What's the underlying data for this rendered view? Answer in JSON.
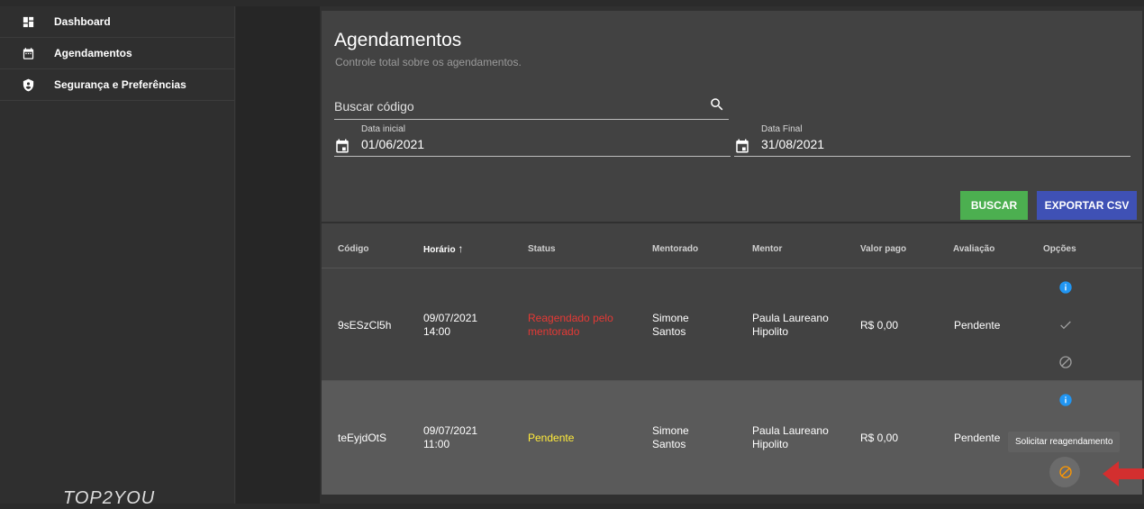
{
  "sidebar": {
    "items": [
      {
        "label": "Dashboard",
        "icon": "dashboard-icon"
      },
      {
        "label": "Agendamentos",
        "icon": "calendar-icon"
      },
      {
        "label": "Segurança e Preferências",
        "icon": "shield-icon"
      }
    ],
    "logo_text": "TOP2YOU"
  },
  "header": {
    "title": "Agendamentos",
    "subtitle": "Controle total sobre os agendamentos."
  },
  "filters": {
    "search_placeholder": "Buscar código",
    "start_label": "Data inicial",
    "start_value": "01/06/2021",
    "end_label": "Data Final",
    "end_value": "31/08/2021"
  },
  "actions": {
    "search_label": "BUSCAR",
    "export_label": "EXPORTAR CSV"
  },
  "table": {
    "columns": [
      "Código",
      "Horário",
      "Status",
      "Mentorado",
      "Mentor",
      "Valor pago",
      "Avaliação",
      "Opções"
    ],
    "sort_indicator": "↑",
    "rows": [
      {
        "code": "9sESzCl5h",
        "date": "09/07/2021",
        "time": "14:00",
        "status_l1": "Reagendado pelo",
        "status_l2": "mentorado",
        "status_color": "#e53935",
        "mentee_l1": "Simone",
        "mentee_l2": "Santos",
        "mentor_l1": "Paula Laureano",
        "mentor_l2": "Hipolito",
        "paid": "R$ 0,00",
        "rating": "Pendente"
      },
      {
        "code": "teEyjdOtS",
        "date": "09/07/2021",
        "time": "11:00",
        "status_l1": "Pendente",
        "status_l2": "",
        "status_color": "#ffeb3b",
        "mentee_l1": "Simone",
        "mentee_l2": "Santos",
        "mentor_l1": "Paula Laureano",
        "mentor_l2": "Hipolito",
        "paid": "R$ 0,00",
        "rating": "Pendente"
      }
    ]
  },
  "tooltip": "Solicitar reagendamento",
  "colors": {
    "info": "#2196f3",
    "muted": "#9e9e9e",
    "warning": "#ff9800",
    "arrow": "#d32f2f"
  }
}
